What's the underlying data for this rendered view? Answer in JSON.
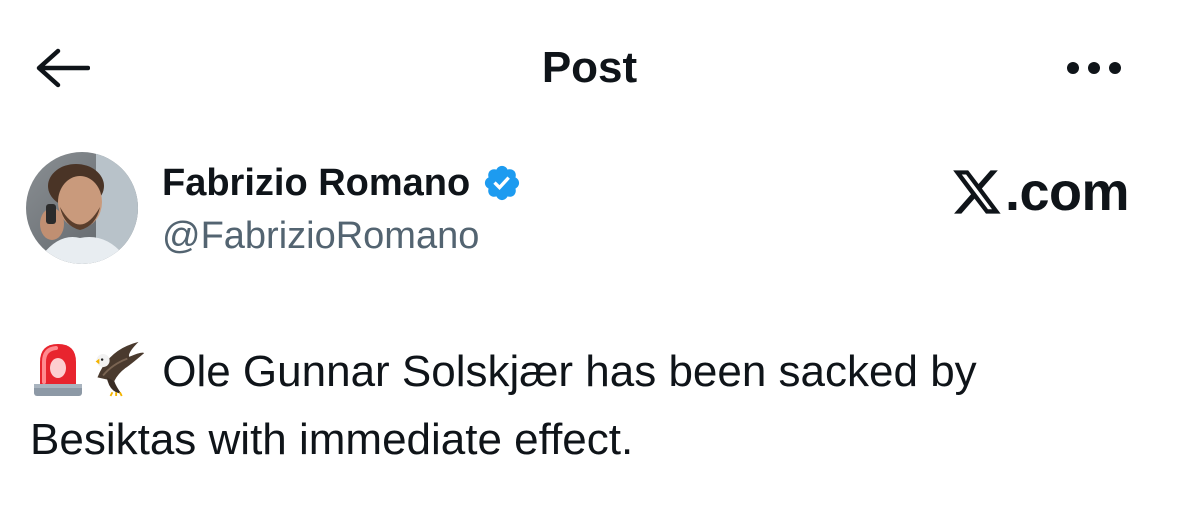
{
  "header": {
    "title": "Post",
    "back_icon": "arrow-left-icon",
    "more_icon": "more-horizontal-icon"
  },
  "author": {
    "name": "Fabrizio Romano",
    "handle": "@FabrizioRomano",
    "verified": true,
    "verified_color": "#1d9bf0"
  },
  "brand": {
    "text": ".com",
    "logo_icon": "x-logo-icon"
  },
  "post": {
    "emojis": [
      "police-light-icon",
      "eagle-icon"
    ],
    "text_line1": "Ole Gunnar Solskjær has been sacked by",
    "text_line2": "Besiktas with immediate effect."
  },
  "colors": {
    "text": "#0f1419",
    "secondary": "#536471",
    "accent": "#1d9bf0"
  }
}
